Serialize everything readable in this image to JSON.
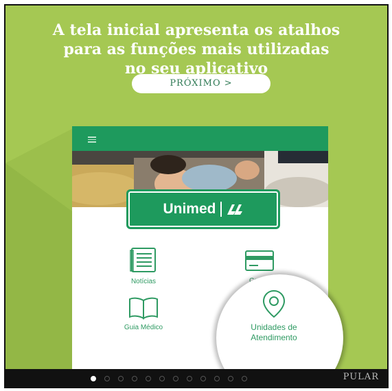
{
  "headline": {
    "line1": "A tela inicial apresenta os atalhos",
    "line2": "para as funções mais utilizadas",
    "line3": "no seu aplicativo"
  },
  "next_button": {
    "label": "PRÓXIMO",
    "chevron": ">"
  },
  "app": {
    "brand": "Unimed",
    "tiles": {
      "noticias": "Notícias",
      "cartao": "Cartão",
      "guia": "Guia Médico"
    },
    "highlight": {
      "line1": "Unidades de",
      "line2": "Atendimento"
    }
  },
  "pager": {
    "page_count": 12,
    "current_page": 1,
    "skip_label": "PULAR"
  },
  "colors": {
    "background": "#a5c853",
    "brand_green": "#1e9a5d",
    "text_green": "#2e9a62"
  }
}
